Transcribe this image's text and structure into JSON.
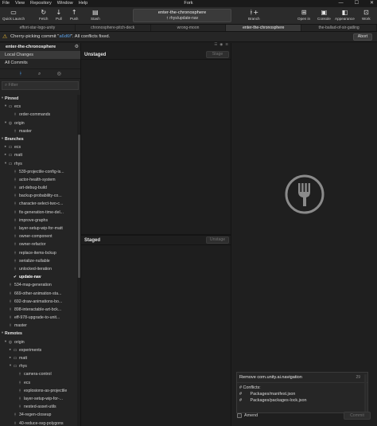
{
  "window": {
    "title": "Fork",
    "menu": [
      "File",
      "View",
      "Repository",
      "Window",
      "Help"
    ],
    "controls": [
      "—",
      "☐",
      "✕"
    ]
  },
  "toolbar": {
    "quick_launch": "Quick Launch",
    "fetch": "Fetch",
    "pull": "Pull",
    "push": "Push",
    "stash": "Stash",
    "branch": "Branch",
    "open_in": "Open in",
    "console": "Console",
    "appearance": "Appearance",
    "workspace": "Work"
  },
  "repo": {
    "name": "enter-the-chronosphere",
    "branch": "rhys/update-nav"
  },
  "tabs": [
    "effort-star-logo-unity",
    "chronosphere-pitch-deck",
    "wrong-moon",
    "enter-the-chronosphere",
    "the-ballad-of-sir-gatling"
  ],
  "banner": {
    "prefix": "Cherry-picking commit \"",
    "hash": "a6d6f",
    "suffix": "\". All conflicts fixed.",
    "abort": "Abort"
  },
  "sidebar": {
    "repo_title": "enter-the-chronosphere",
    "local_changes": "Local Changes",
    "all_commits": "All Commits",
    "filter_placeholder": "Filter",
    "pinned_header": "Pinned",
    "pinned_ecs": "ecs",
    "pinned_order_commands": "order-commands",
    "pinned_origin": "origin",
    "pinned_master": "master",
    "branches_header": "Branches",
    "br_ecs": "ecs",
    "br_matt": "matt",
    "br_rhys": "rhys",
    "rhys_items": [
      "539-projectile-config-is...",
      "actor-health-system",
      "art-debug-build",
      "backup-probability-co...",
      "character-select-two-c...",
      "fix-generation-time-del...",
      "improve-graphs",
      "layer-setup-wip-for-matt",
      "owner-component",
      "owner-refactor",
      "replace-items-bckup",
      "serialize-nullable",
      "unlocked-iteration"
    ],
    "current_branch": "update-nav",
    "top_branches": [
      "534-map-generation",
      "669-other-animation-sta...",
      "692-draw-animations-bo...",
      "898-interactable-art-bck...",
      "eff-978-upgrade-to-unit...",
      "master"
    ],
    "remotes_header": "Remotes",
    "remote_origin": "origin",
    "remote_experiments": "experiments",
    "remote_matt": "matt",
    "remote_rhys": "rhys",
    "remote_rhys_items": [
      "camera-control",
      "ecs",
      "explosions-as-projectile",
      "layer-setup-wip-for-...",
      "nested-asset-utils"
    ],
    "remote_tail": [
      "34-regen-closeup",
      "40-reduce-svg-polygons"
    ]
  },
  "changes": {
    "unstaged_title": "Unstaged",
    "stage_button": "Stage",
    "staged_title": "Staged",
    "unstage_button": "Unstage"
  },
  "commit": {
    "summary": "Remove com.unity.ai.navigation",
    "char_count": "29",
    "description": "# Conflicts:\n#       Packages/manifest.json\n#       Packages/packages-lock.json",
    "amend_label": "Amend",
    "commit_button": "Commit"
  },
  "colors": {
    "accent": "#4d9be8",
    "warning": "#e8b730",
    "hash": "#5aa0e6"
  }
}
